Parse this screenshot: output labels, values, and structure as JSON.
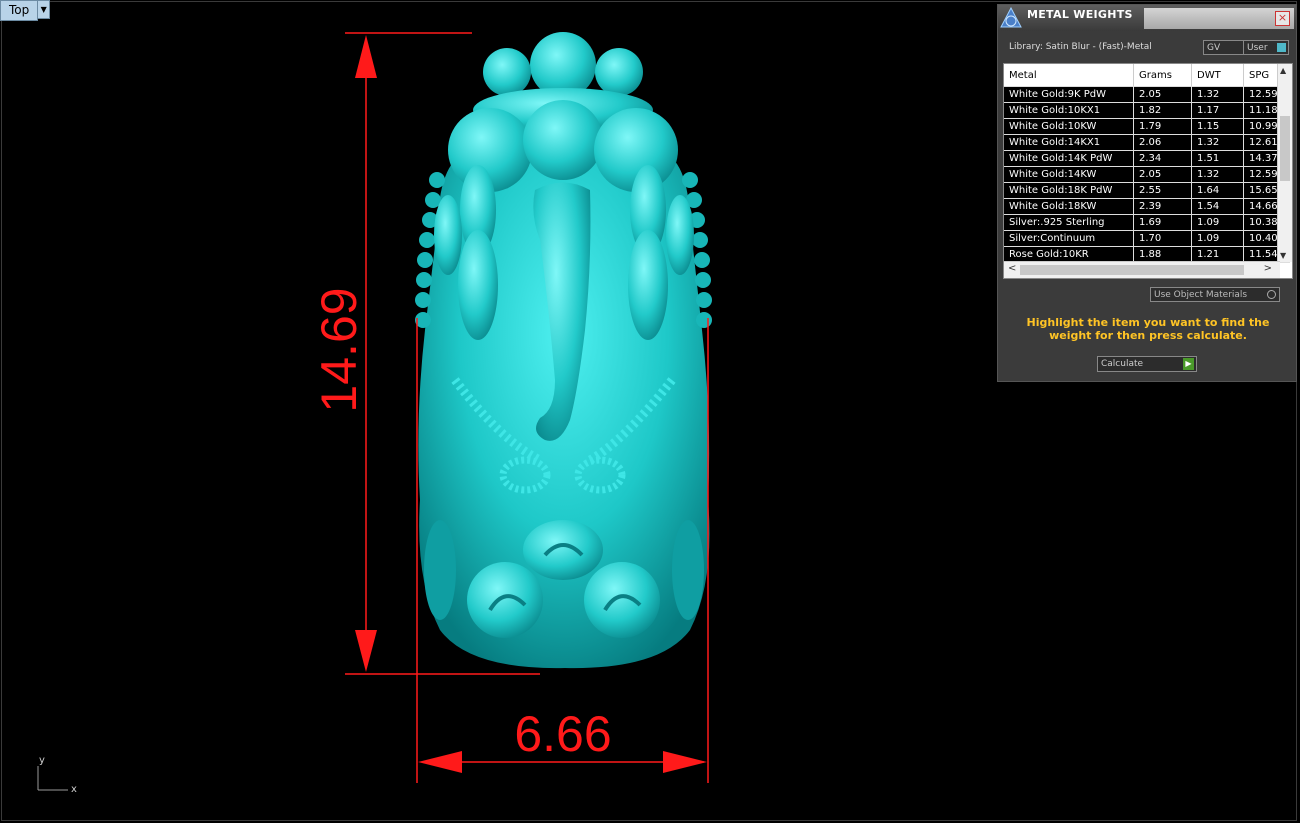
{
  "viewport": {
    "view_name": "Top",
    "axis_y": "y",
    "axis_x": "x",
    "dimensions": {
      "height_value": "14.69",
      "width_value": "6.66"
    },
    "colors": {
      "dimension": "#ff1a1a",
      "model": "#1fc9c9",
      "background": "#000000"
    }
  },
  "panel": {
    "title": "METAL WEIGHTS",
    "library_label": "Library: Satin Blur - (Fast)-Metal",
    "toggle_gv": "GV",
    "toggle_user": "User",
    "columns": [
      "Metal",
      "Grams",
      "DWT",
      "SPG"
    ],
    "rows": [
      [
        "White Gold:9K PdW",
        "2.05",
        "1.32",
        "12.59"
      ],
      [
        "White Gold:10KX1",
        "1.82",
        "1.17",
        "11.18"
      ],
      [
        "White Gold:10KW",
        "1.79",
        "1.15",
        "10.99"
      ],
      [
        "White Gold:14KX1",
        "2.06",
        "1.32",
        "12.61"
      ],
      [
        "White Gold:14K PdW",
        "2.34",
        "1.51",
        "14.37"
      ],
      [
        "White Gold:14KW",
        "2.05",
        "1.32",
        "12.59"
      ],
      [
        "White Gold:18K PdW",
        "2.55",
        "1.64",
        "15.65"
      ],
      [
        "White Gold:18KW",
        "2.39",
        "1.54",
        "14.66"
      ],
      [
        "Silver:.925 Sterling",
        "1.69",
        "1.09",
        "10.38"
      ],
      [
        "Silver:Continuum",
        "1.70",
        "1.09",
        "10.40"
      ],
      [
        "Rose Gold:10KR",
        "1.88",
        "1.21",
        "11.54"
      ]
    ],
    "use_object_materials": "Use Object Materials",
    "instruction": "Highlight the item you want to find the weight for then press calculate.",
    "calculate_label": "Calculate"
  }
}
